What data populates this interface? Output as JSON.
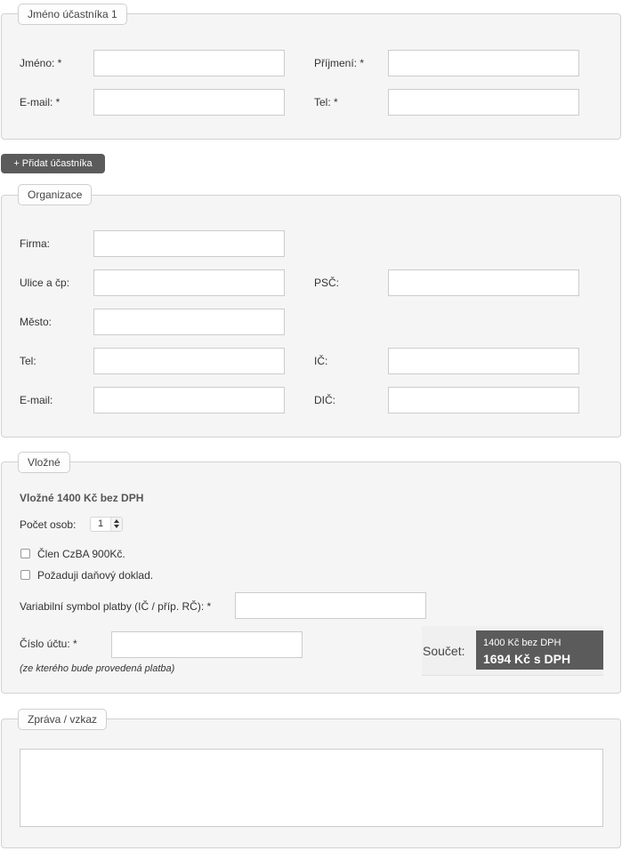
{
  "participant": {
    "legend": "Jméno účastníka 1",
    "first_name_label": "Jméno: *",
    "last_name_label": "Příjmení: *",
    "email_label": "E-mail: *",
    "phone_label": "Tel: *"
  },
  "add_participant_label": "+ Přidat účastníka",
  "organization": {
    "legend": "Organizace",
    "company_label": "Firma:",
    "street_label": "Ulice a čp:",
    "zip_label": "PSČ:",
    "city_label": "Město:",
    "phone_label": "Tel:",
    "ic_label": "IČ:",
    "email_label": "E-mail:",
    "dic_label": "DIČ:"
  },
  "fee": {
    "legend": "Vložné",
    "title": "Vložné 1400 Kč bez DPH",
    "persons_label": "Počet osob:",
    "persons_value": "1",
    "member_label": "Člen CzBA 900Kč.",
    "tax_doc_label": "Požaduji daňový doklad.",
    "varsym_label": "Variabilní symbol platby (IČ / příp. RČ): *",
    "account_label": "Číslo účtu: *",
    "account_note": "(ze kterého bude provedená platba)",
    "sum_label": "Součet:",
    "sum_net": "1400 Kč bez DPH",
    "sum_gross": "1694 Kč s DPH"
  },
  "message": {
    "legend": "Zpráva / vzkaz"
  }
}
